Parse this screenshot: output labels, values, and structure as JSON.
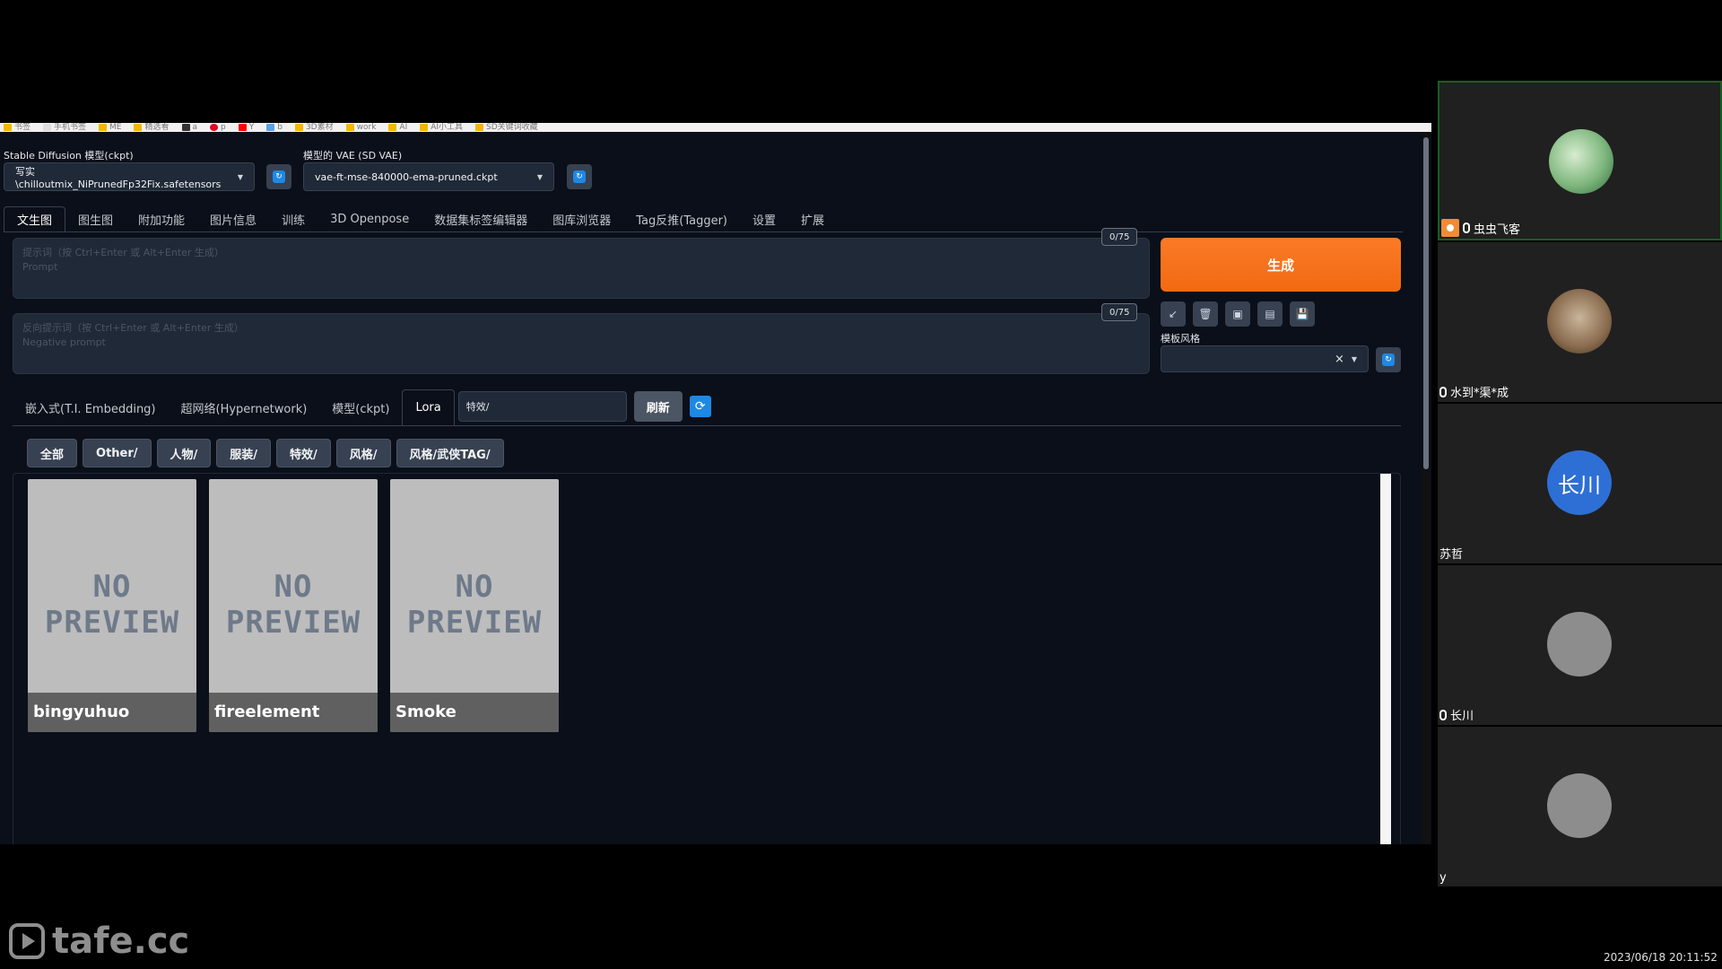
{
  "bookmarks": [
    "书签",
    "手机书签",
    "ME",
    "精选看",
    "a",
    "p",
    "Y",
    "b",
    "3D素材",
    "work",
    "AI",
    "AI小工具",
    "SD关键词收藏"
  ],
  "model": {
    "label": "Stable Diffusion 模型(ckpt)",
    "value": "写实\\chilloutmix_NiPrunedFp32Fix.safetensors"
  },
  "vae": {
    "label": "模型的 VAE (SD VAE)",
    "value": "vae-ft-mse-840000-ema-pruned.ckpt"
  },
  "tabs": [
    "文生图",
    "图生图",
    "附加功能",
    "图片信息",
    "训练",
    "3D Openpose",
    "数据集标签编辑器",
    "图库浏览器",
    "Tag反推(Tagger)",
    "设置",
    "扩展"
  ],
  "prompt": {
    "placeholder_1": "提示词（按 Ctrl+Enter 或 Alt+Enter 生成）",
    "placeholder_2": "Prompt",
    "counter": "0/75"
  },
  "negative_prompt": {
    "placeholder_1": "反向提示词（按 Ctrl+Enter 或 Alt+Enter 生成）",
    "placeholder_2": "Negative prompt",
    "counter": "0/75"
  },
  "generate_label": "生成",
  "tools": [
    "↙",
    "🗑",
    "▣",
    "▤",
    "💾"
  ],
  "styles": {
    "label": "模板风格",
    "clear": "×"
  },
  "extra_tabs": [
    "嵌入式(T.I. Embedding)",
    "超网络(Hypernetwork)",
    "模型(ckpt)",
    "Lora"
  ],
  "search_value": "特效/",
  "refresh_label": "刷新",
  "filters": [
    "全部",
    "Other/",
    "人物/",
    "服装/",
    "特效/",
    "风格/",
    "风格/武侠TAG/"
  ],
  "cards": [
    {
      "name": "bingyuhuo",
      "preview_line1": "NO",
      "preview_line2": "PREVIEW"
    },
    {
      "name": "fireelement",
      "preview_line1": "NO",
      "preview_line2": "PREVIEW"
    },
    {
      "name": "Smoke",
      "preview_line1": "NO",
      "preview_line2": "PREVIEW"
    }
  ],
  "participants": [
    {
      "name": "虫虫飞客",
      "avatar_color": "#7fb77e",
      "avatar_text": "",
      "host": true,
      "speaking": true
    },
    {
      "name": "水到*渠*成",
      "avatar_color": "#8a6b4e",
      "avatar_text": "",
      "host": false,
      "speaking": false
    },
    {
      "name": "苏哲",
      "avatar_color": "#2e6fd6",
      "avatar_text": "长川",
      "host": false,
      "speaking": false
    },
    {
      "name": "长川",
      "avatar_color": "#8d8d8d",
      "avatar_text": "",
      "host": false,
      "speaking": false
    },
    {
      "name": "y",
      "avatar_color": "#8d8d8d",
      "avatar_text": "",
      "host": false,
      "speaking": false
    }
  ],
  "watermark": "tafe.cc",
  "timestamp": "2023/06/18 20:11:52",
  "colors": {
    "accent_orange": "#f26a12",
    "accent_blue": "#1e88e5",
    "app_bg": "#0b0f19"
  }
}
